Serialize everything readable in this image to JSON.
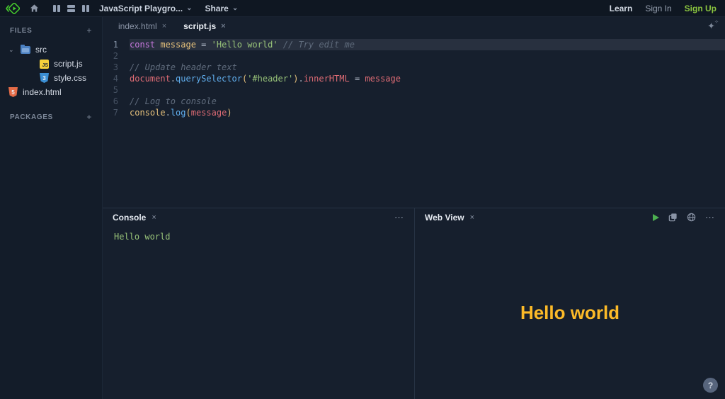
{
  "topbar": {
    "title": "JavaScript Playgro...",
    "chevron": "⌄",
    "share_label": "Share",
    "learn_label": "Learn",
    "signin_label": "Sign In",
    "signup_label": "Sign Up",
    "signup_color": "#8bc53f"
  },
  "sidebar": {
    "files_header": "FILES",
    "packages_header": "PACKAGES",
    "add_label": "+",
    "src_chevron": "⌄",
    "items": [
      {
        "label": "src",
        "type": "folder"
      },
      {
        "label": "script.js",
        "type": "js"
      },
      {
        "label": "style.css",
        "type": "css"
      },
      {
        "label": "index.html",
        "type": "html"
      }
    ],
    "js_badge_text": "JS",
    "css_badge_text": "3",
    "html_badge_text": "5"
  },
  "editor": {
    "tabs": [
      {
        "label": "index.html",
        "active": false
      },
      {
        "label": "script.js",
        "active": true
      }
    ],
    "close_glyph": "×",
    "sparkle_glyph": "✦",
    "sparkle_dot": "✧",
    "lines": [
      {
        "num": "1",
        "active": true,
        "tokens": [
          {
            "text": "const",
            "type": "keyword"
          },
          {
            "text": " ",
            "type": "plain"
          },
          {
            "text": "message",
            "type": "def"
          },
          {
            "text": " = ",
            "type": "plain"
          },
          {
            "text": "'Hello world'",
            "type": "string"
          },
          {
            "text": " ",
            "type": "plain"
          },
          {
            "text": "// Try edit me",
            "type": "comment"
          }
        ]
      },
      {
        "num": "2",
        "active": false,
        "tokens": []
      },
      {
        "num": "3",
        "active": false,
        "tokens": [
          {
            "text": "// Update header text",
            "type": "comment"
          }
        ]
      },
      {
        "num": "4",
        "active": false,
        "tokens": [
          {
            "text": "document",
            "type": "var"
          },
          {
            "text": ".",
            "type": "plain"
          },
          {
            "text": "querySelector",
            "type": "fn"
          },
          {
            "text": "(",
            "type": "paren"
          },
          {
            "text": "'#header'",
            "type": "string"
          },
          {
            "text": ")",
            "type": "paren"
          },
          {
            "text": ".",
            "type": "plain"
          },
          {
            "text": "innerHTML",
            "type": "var"
          },
          {
            "text": " = ",
            "type": "plain"
          },
          {
            "text": "message",
            "type": "var"
          }
        ]
      },
      {
        "num": "5",
        "active": false,
        "tokens": []
      },
      {
        "num": "6",
        "active": false,
        "tokens": [
          {
            "text": "// Log to console",
            "type": "comment"
          }
        ]
      },
      {
        "num": "7",
        "active": false,
        "tokens": [
          {
            "text": "console",
            "type": "def"
          },
          {
            "text": ".",
            "type": "plain"
          },
          {
            "text": "log",
            "type": "fn"
          },
          {
            "text": "(",
            "type": "paren"
          },
          {
            "text": "message",
            "type": "var"
          },
          {
            "text": ")",
            "type": "paren"
          }
        ]
      }
    ]
  },
  "console_panel": {
    "title": "Console",
    "close_glyph": "×",
    "menu_glyph": "⋯",
    "output": "Hello world",
    "output_color": "#98c379"
  },
  "webview_panel": {
    "title": "Web View",
    "close_glyph": "×",
    "menu_glyph": "⋯",
    "content_text": "Hello world",
    "content_color": "#fcba28"
  },
  "help_label": "?"
}
